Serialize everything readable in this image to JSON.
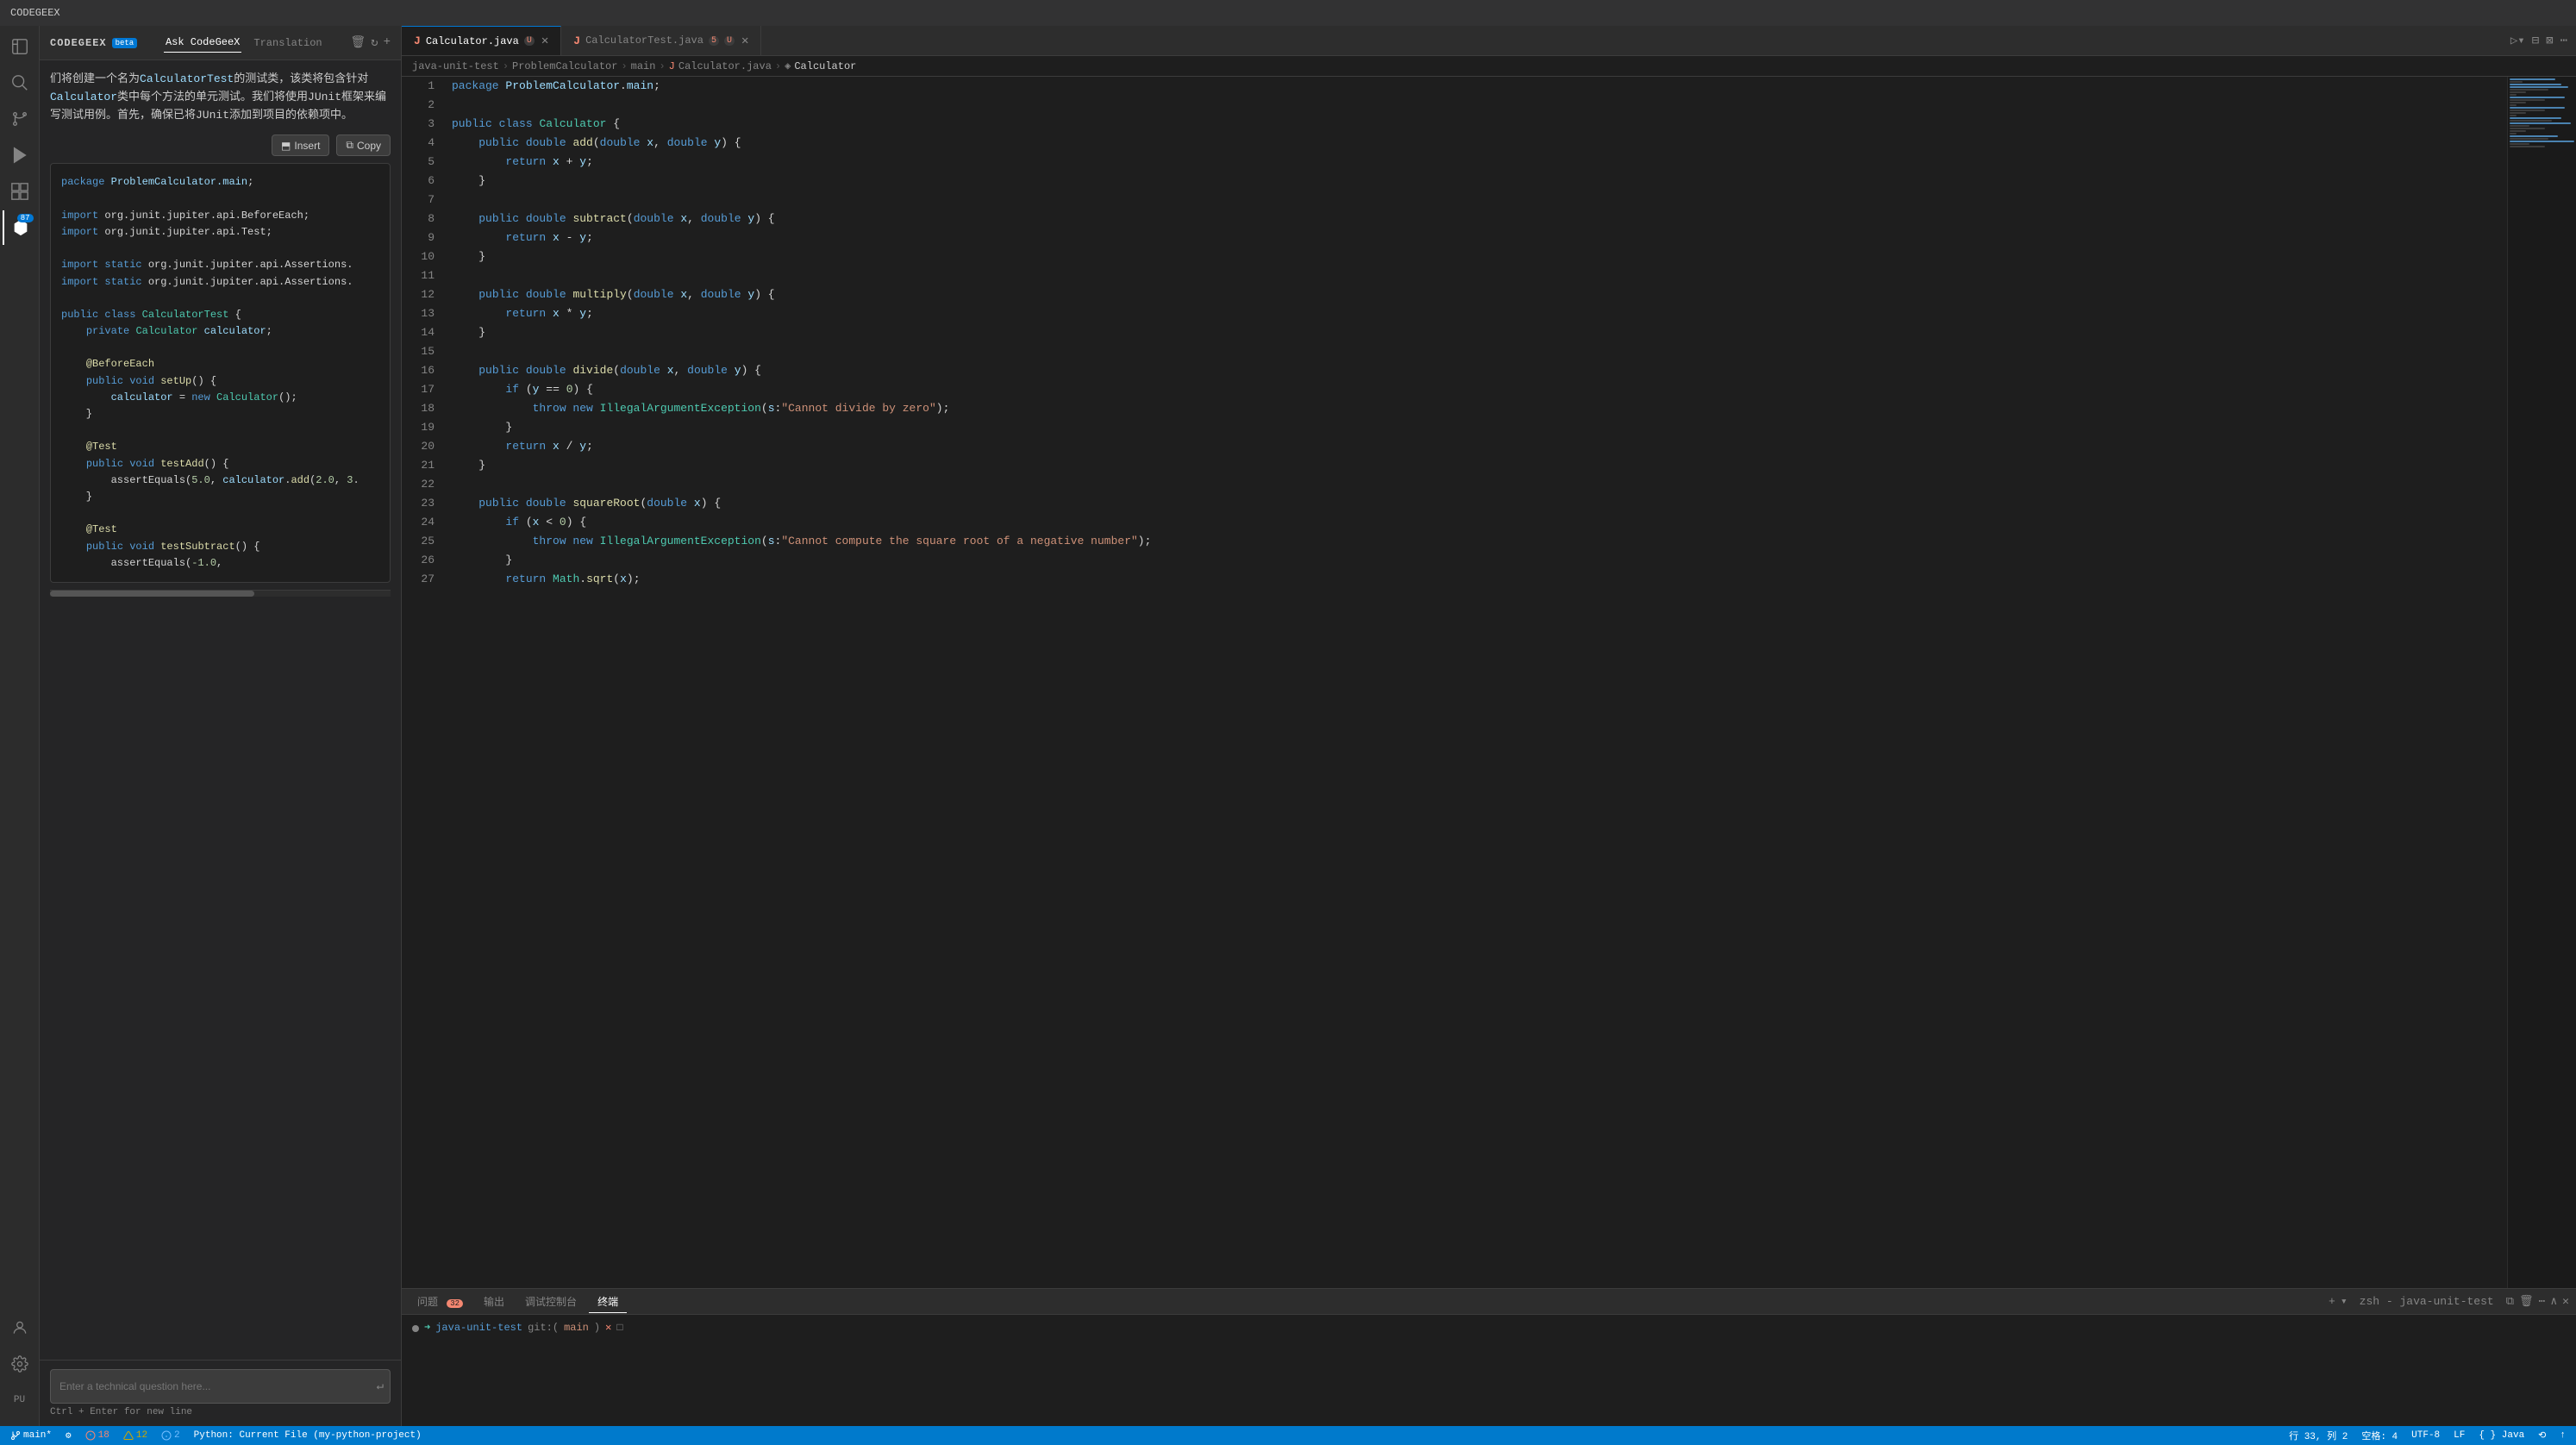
{
  "titleBar": {
    "title": "CODEGEEX"
  },
  "activityBar": {
    "icons": [
      {
        "name": "files-icon",
        "symbol": "⧉",
        "active": false
      },
      {
        "name": "search-icon",
        "symbol": "🔍",
        "active": false
      },
      {
        "name": "source-control-icon",
        "symbol": "⎇",
        "active": false
      },
      {
        "name": "run-icon",
        "symbol": "▷",
        "active": false
      },
      {
        "name": "extensions-icon",
        "symbol": "⊞",
        "active": false
      },
      {
        "name": "codegex-icon",
        "symbol": "◈",
        "active": true,
        "badge": "87"
      }
    ],
    "bottomIcons": [
      {
        "name": "account-icon",
        "symbol": "👤"
      },
      {
        "name": "settings-icon",
        "symbol": "⚙"
      }
    ]
  },
  "sidebar": {
    "header": {
      "title": "CODEGEEX",
      "betaLabel": "beta",
      "tabs": [
        {
          "label": "Ask CodeGeeX",
          "active": true
        },
        {
          "label": "Translation",
          "active": false
        }
      ],
      "icons": [
        "🗑",
        "↻",
        "+"
      ]
    },
    "aiMessage": "们将创建一个名为CalculatorTest的测试类，该类将包含针对Calculator类中每个方法的单元测试。我们将使用JUnit框架来编写测试用例。首先，确保已将JUnit添加到项目的依赖项中。",
    "actionButtons": [
      {
        "label": "Insert",
        "icon": "⬒"
      },
      {
        "label": "Copy",
        "icon": "⧉"
      }
    ],
    "codeBlock": {
      "lines": [
        "package ProblemCalculator.main;",
        "",
        "import org.junit.jupiter.api.BeforeEach;",
        "import org.junit.jupiter.api.Test;",
        "",
        "import static org.junit.jupiter.api.Assertions.",
        "import static org.junit.jupiter.api.Assertions.",
        "",
        "public class CalculatorTest {",
        "    private Calculator calculator;",
        "",
        "    @BeforeEach",
        "    public void setUp() {",
        "        calculator = new Calculator();",
        "    }",
        "",
        "    @Test",
        "    public void testAdd() {",
        "        assertEquals(5.0, calculator.add(2.0, 3.",
        "    }",
        "",
        "    @Test",
        "    public void testSubtract() {",
        "        assertEquals(-1.0,"
      ]
    },
    "inputPlaceholder": "Enter a technical question here...",
    "inputHint": "Ctrl + Enter for new line"
  },
  "tabBar": {
    "tabs": [
      {
        "label": "Calculator.java",
        "icon": "J",
        "active": true,
        "modified": "U",
        "closable": true
      },
      {
        "label": "CalculatorTest.java",
        "icon": "J",
        "active": false,
        "badge": "5",
        "modified": "U",
        "closable": true
      }
    ],
    "actions": [
      "▷▾",
      "⊟",
      "⊠",
      "⋯"
    ]
  },
  "breadcrumb": {
    "parts": [
      "java-unit-test",
      "ProblemCalculator",
      "main",
      "Calculator.java",
      "Calculator"
    ]
  },
  "editor": {
    "lines": [
      {
        "num": 1,
        "code": "package ProblemCalculator.main;"
      },
      {
        "num": 2,
        "code": ""
      },
      {
        "num": 3,
        "code": "public class Calculator {"
      },
      {
        "num": 4,
        "code": "    public double add(double x, double y) {"
      },
      {
        "num": 5,
        "code": "        return x + y;"
      },
      {
        "num": 6,
        "code": "    }"
      },
      {
        "num": 7,
        "code": ""
      },
      {
        "num": 8,
        "code": "    public double subtract(double x, double y) {"
      },
      {
        "num": 9,
        "code": "        return x - y;"
      },
      {
        "num": 10,
        "code": "    }"
      },
      {
        "num": 11,
        "code": ""
      },
      {
        "num": 12,
        "code": "    public double multiply(double x, double y) {"
      },
      {
        "num": 13,
        "code": "        return x * y;"
      },
      {
        "num": 14,
        "code": "    }"
      },
      {
        "num": 15,
        "code": ""
      },
      {
        "num": 16,
        "code": "    public double divide(double x, double y) {"
      },
      {
        "num": 17,
        "code": "        if (y == 0) {"
      },
      {
        "num": 18,
        "code": "            throw new IllegalArgumentException(s:\"Cannot divide by zero\");"
      },
      {
        "num": 19,
        "code": "        }"
      },
      {
        "num": 20,
        "code": "        return x / y;"
      },
      {
        "num": 21,
        "code": "    }"
      },
      {
        "num": 22,
        "code": ""
      },
      {
        "num": 23,
        "code": "    public double squareRoot(double x) {"
      },
      {
        "num": 24,
        "code": "        if (x < 0) {"
      },
      {
        "num": 25,
        "code": "            throw new IllegalArgumentException(s:\"Cannot compute the square root of a negative number\");"
      },
      {
        "num": 26,
        "code": "        }"
      },
      {
        "num": 27,
        "code": "        return Math.sqrt(x);"
      }
    ]
  },
  "bottomPanel": {
    "tabs": [
      {
        "label": "问题",
        "badge": "32",
        "active": false
      },
      {
        "label": "输出",
        "active": false
      },
      {
        "label": "调试控制台",
        "active": false
      },
      {
        "label": "终端",
        "active": true
      }
    ],
    "actions": [
      "+",
      "▾",
      "zsh - java-unit-test",
      "⧉",
      "🗑",
      "⋯",
      "∧",
      "✕"
    ],
    "terminal": {
      "prompt": "java-unit-test git:(main) ✕ □"
    }
  },
  "statusBar": {
    "left": [
      {
        "label": "✕ main*",
        "name": "branch"
      },
      {
        "label": "⚙"
      },
      {
        "label": "⚠ 18"
      },
      {
        "label": "⚠ 12"
      },
      {
        "label": "⊗ 2"
      },
      {
        "label": "Python: Current File (my-python-project)"
      }
    ],
    "right": [
      {
        "label": "行 33, 列 2"
      },
      {
        "label": "空格: 4"
      },
      {
        "label": "UTF-8"
      },
      {
        "label": "LF"
      },
      {
        "label": "{ } Java"
      },
      {
        "label": "⟲"
      },
      {
        "label": "↑"
      }
    ]
  }
}
